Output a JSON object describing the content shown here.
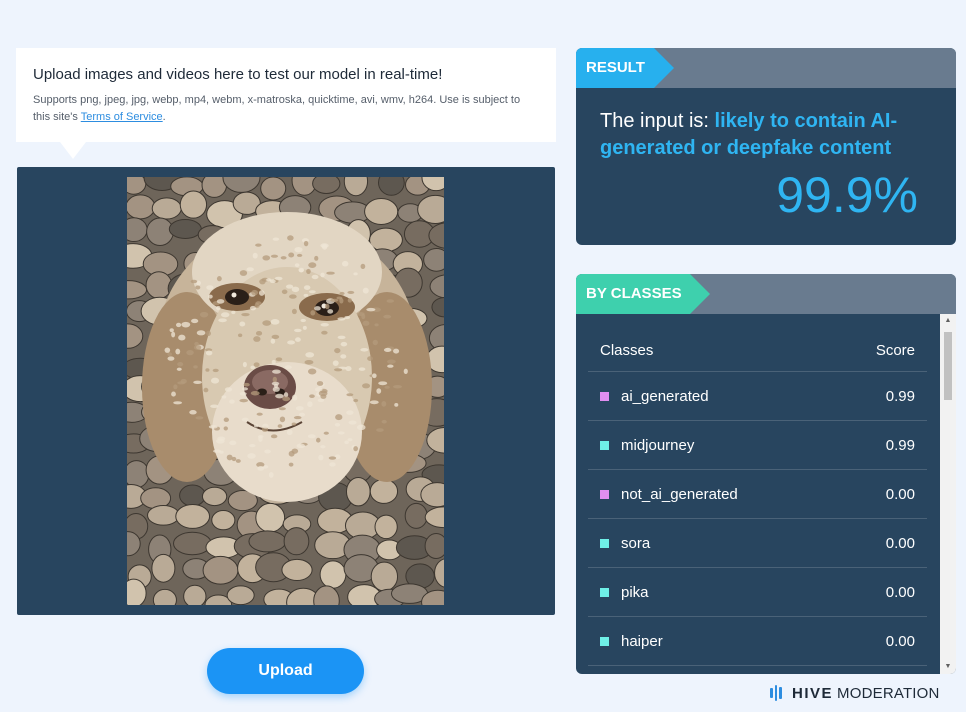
{
  "upload_info": {
    "title": "Upload images and videos here to test our model in real-time!",
    "supports_text": "Supports png, jpeg, jpg, webp, mp4, webm, x-matroska, quicktime, avi, wmv, h264. Use is subject to this site's ",
    "terms_link": "Terms of Service",
    "terms_suffix": "."
  },
  "upload_button": {
    "label": "Upload"
  },
  "result": {
    "tag": "RESULT",
    "prefix": "The input is: ",
    "verdict": "likely to contain AI-generated or deepfake content",
    "percentage": "99.9%"
  },
  "classes": {
    "tag": "BY CLASSES",
    "header_class": "Classes",
    "header_score": "Score",
    "rows": [
      {
        "name": "ai_generated",
        "score": "0.99",
        "color": "#e08ef0"
      },
      {
        "name": "midjourney",
        "score": "0.99",
        "color": "#6ff0e8"
      },
      {
        "name": "not_ai_generated",
        "score": "0.00",
        "color": "#e08ef0"
      },
      {
        "name": "sora",
        "score": "0.00",
        "color": "#6ff0e8"
      },
      {
        "name": "pika",
        "score": "0.00",
        "color": "#6ff0e8"
      },
      {
        "name": "haiper",
        "score": "0.00",
        "color": "#6ff0e8"
      }
    ]
  },
  "brand": {
    "name_bold": "HIVE",
    "name_light": "MODERATION"
  },
  "colors": {
    "accent_blue": "#2fb5f2",
    "accent_teal": "#3ed0ad",
    "panel_bg": "#28455f",
    "button_blue": "#1b94f5"
  },
  "icons": {
    "scroll_up": "triangle-up-icon",
    "scroll_down": "triangle-down-icon",
    "brand_logo": "hive-bars-logo"
  }
}
